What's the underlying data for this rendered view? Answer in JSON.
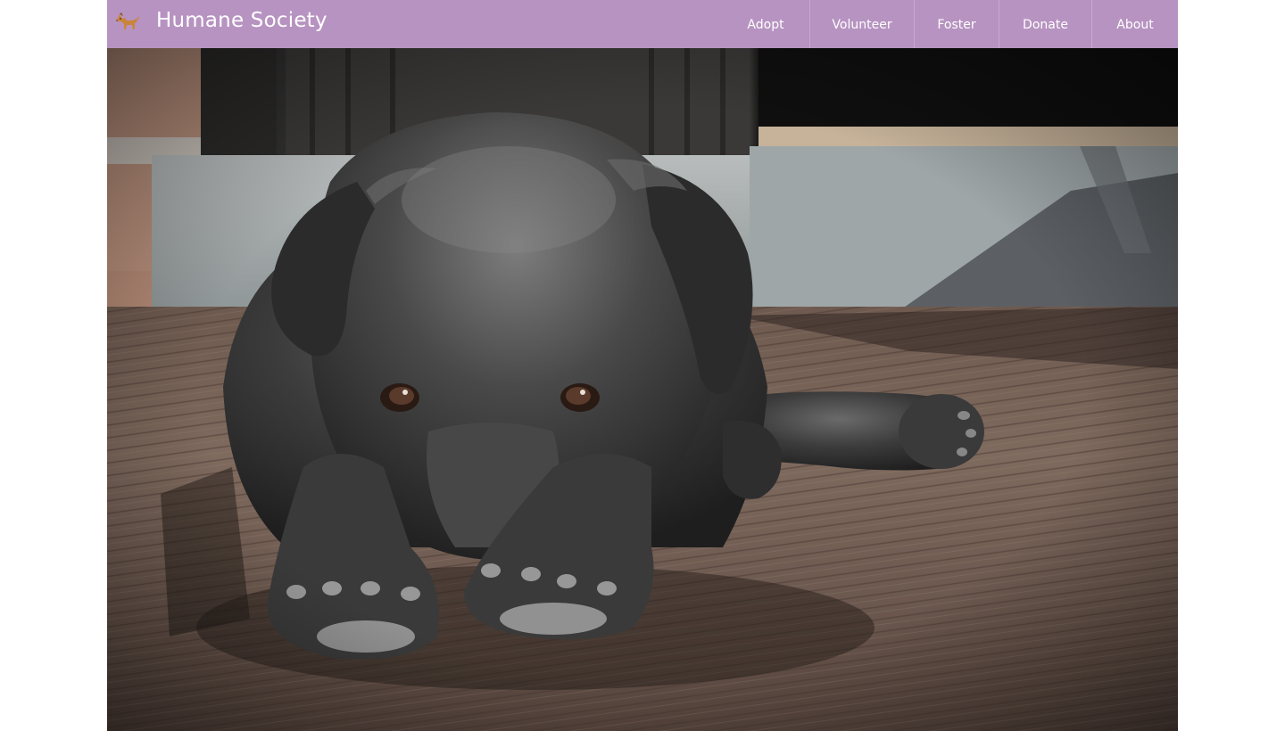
{
  "brand": {
    "title": "Humane Society",
    "icon": "dog-icon"
  },
  "nav": {
    "items": [
      {
        "label": "Adopt"
      },
      {
        "label": "Volunteer"
      },
      {
        "label": "Foster"
      },
      {
        "label": "Donate"
      },
      {
        "label": "About"
      }
    ]
  },
  "hero": {
    "image": "black-puppy-lying-on-wooden-porch"
  },
  "colors": {
    "navbar": "#b793c1",
    "nav_text": "#ffffff",
    "page_background": "#ffffff"
  }
}
